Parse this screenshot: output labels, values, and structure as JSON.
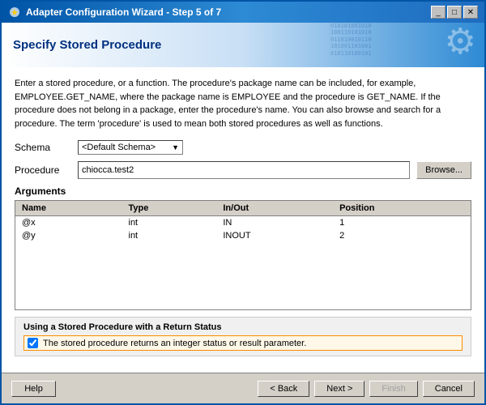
{
  "window": {
    "title": "Adapter Configuration Wizard - Step 5 of 7",
    "icon": "⚙"
  },
  "header": {
    "title": "Specify Stored Procedure"
  },
  "description": {
    "text": "Enter a stored procedure, or a function. The procedure's package name can be included, for example, EMPLOYEE.GET_NAME, where the package name is EMPLOYEE and the procedure is GET_NAME.  If the procedure does not belong in a package, enter the procedure's name. You can also browse and search for a procedure. The term 'procedure' is used to mean both stored procedures as well as functions."
  },
  "form": {
    "schema_label": "Schema",
    "schema_value": "<Default Schema>",
    "procedure_label": "Procedure",
    "procedure_value": "chiocca.test2",
    "browse_label": "Browse..."
  },
  "arguments": {
    "section_title": "Arguments",
    "columns": [
      "Name",
      "Type",
      "In/Out",
      "Position"
    ],
    "rows": [
      {
        "name": "@x",
        "type": "int",
        "inout": "IN",
        "position": "1"
      },
      {
        "name": "@y",
        "type": "int",
        "inout": "INOUT",
        "position": "2"
      }
    ]
  },
  "return_status": {
    "title": "Using a Stored Procedure with a Return Status",
    "checkbox_checked": true,
    "checkbox_label": "The stored procedure returns an integer status or result parameter."
  },
  "footer": {
    "help_label": "Help",
    "back_label": "< Back",
    "next_label": "Next >",
    "finish_label": "Finish",
    "cancel_label": "Cancel"
  },
  "title_controls": {
    "minimize": "_",
    "maximize": "□",
    "close": "✕"
  }
}
